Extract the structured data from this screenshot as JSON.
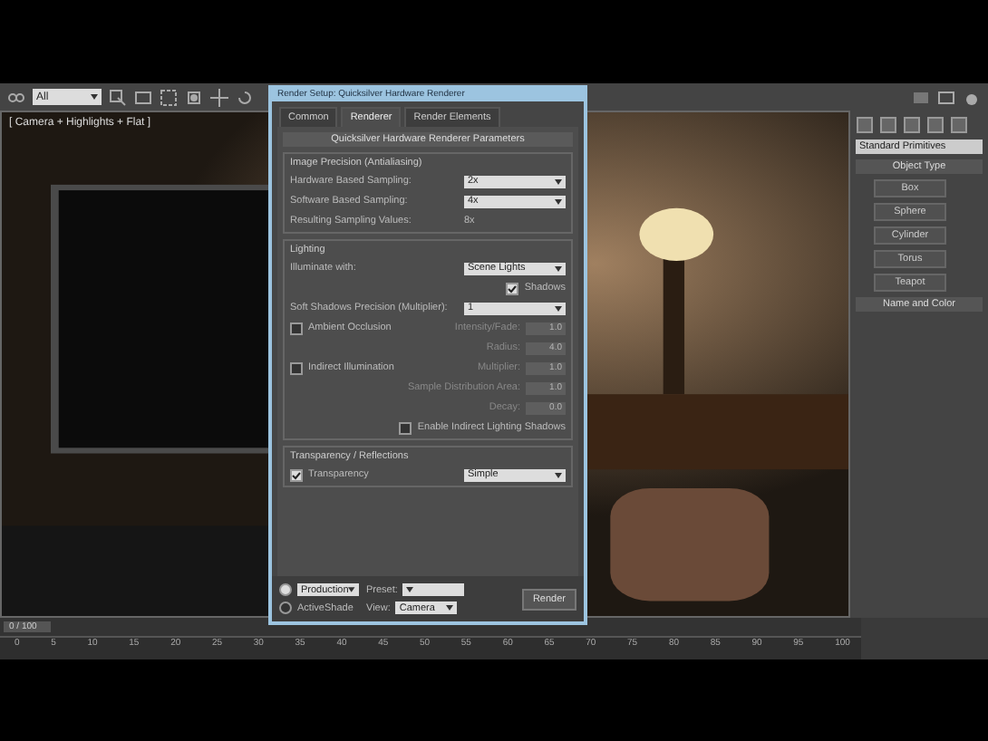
{
  "toolbar": {
    "selection_filter": "All"
  },
  "viewport": {
    "label": "[ Camera + Highlights + Flat ]"
  },
  "dialog": {
    "title": "Render Setup: Quicksilver Hardware Renderer",
    "tabs": [
      {
        "label": "Common",
        "selected": false
      },
      {
        "label": "Renderer",
        "selected": true
      },
      {
        "label": "Render Elements",
        "selected": false
      }
    ],
    "rollout_title": "Quicksilver Hardware Renderer Parameters",
    "sections": [
      {
        "title": "Image Precision (Antialiasing)",
        "rows": [
          {
            "kind": "dropdown",
            "label": "Hardware Based Sampling:",
            "value": "2x"
          },
          {
            "kind": "dropdown",
            "label": "Software Based Sampling:",
            "value": "4x"
          },
          {
            "kind": "readout",
            "label": "Resulting Sampling Values:",
            "value": "8x"
          }
        ]
      },
      {
        "title": "Lighting",
        "rows": [
          {
            "kind": "dropdown",
            "label": "Illuminate with:",
            "value": "Scene Lights"
          },
          {
            "kind": "check",
            "label": "Shadows",
            "checked": true
          },
          {
            "kind": "dropdown",
            "label": "Soft Shadows Precision (Multiplier):",
            "value": "1"
          },
          {
            "kind": "check_spinner",
            "check_label": "Ambient Occlusion",
            "checked": false,
            "label": "Intensity/Fade:",
            "value": "1.0",
            "disabled": true
          },
          {
            "kind": "spinner",
            "label": "Radius:",
            "value": "4.0",
            "disabled": true
          },
          {
            "kind": "check_spinner",
            "check_label": "Indirect Illumination",
            "checked": false,
            "label": "Multiplier:",
            "value": "1.0",
            "disabled": true
          },
          {
            "kind": "spinner",
            "label": "Sample Distribution Area:",
            "value": "1.0",
            "disabled": true
          },
          {
            "kind": "spinner",
            "label": "Decay:",
            "value": "0.0",
            "disabled": true
          },
          {
            "kind": "check",
            "label": "Enable Indirect Lighting Shadows",
            "checked": false
          }
        ]
      },
      {
        "title": "Transparency / Reflections",
        "rows": [
          {
            "kind": "check_dropdown",
            "label": "Transparency",
            "checked": true,
            "value": "Simple"
          }
        ]
      }
    ],
    "modes": [
      {
        "label": "Production",
        "selected": true,
        "kind": "dropdown"
      },
      {
        "label": "ActiveShade",
        "selected": false,
        "kind": "plain"
      }
    ],
    "preset": {
      "label": "Preset:"
    },
    "view": {
      "label": "View:",
      "value": "Camera"
    },
    "render_button": "Render"
  },
  "command_panel": {
    "category": "Standard Primitives",
    "object_type": "Object Type",
    "buttons": [
      "Box",
      "Sphere",
      "Cylinder",
      "Torus",
      "Teapot"
    ],
    "name_rollout": "Name and Color"
  },
  "timeline": {
    "slider": "0 / 100",
    "level": 0,
    "ticks": [
      "0",
      "5",
      "10",
      "15",
      "20",
      "25",
      "30",
      "35",
      "40",
      "45",
      "50",
      "55",
      "60",
      "65",
      "70",
      "75",
      "80",
      "85",
      "90",
      "95",
      "100"
    ]
  }
}
